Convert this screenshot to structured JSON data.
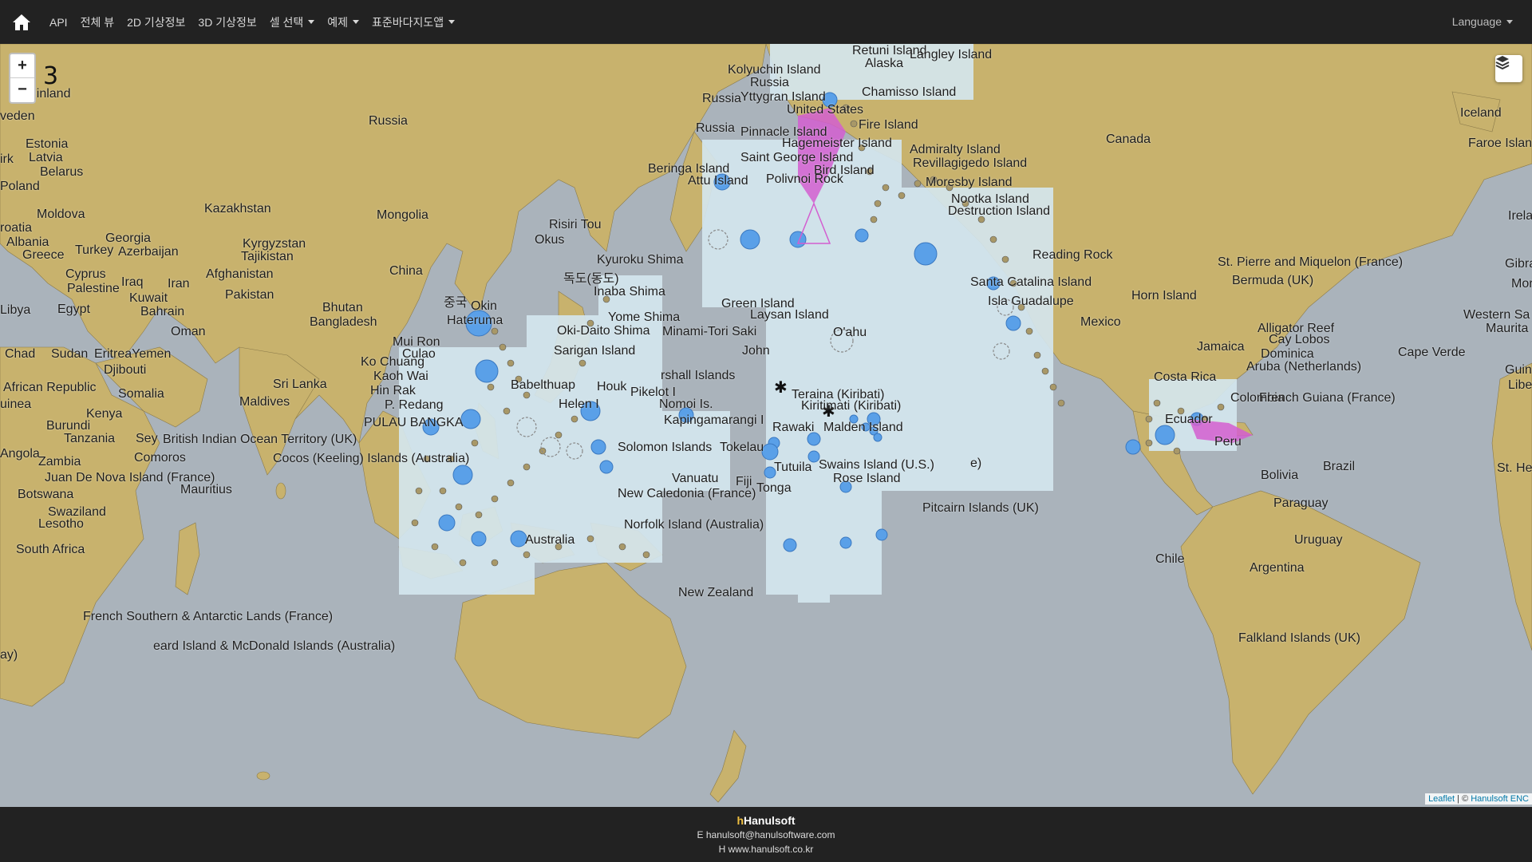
{
  "nav": {
    "items": [
      "API",
      "전체 뷰",
      "2D 기상정보",
      "3D 기상정보"
    ],
    "dropdowns": [
      "셀 선택",
      "예제",
      "표준바다지도앱"
    ],
    "language": "Language"
  },
  "map": {
    "zoom_in": "+",
    "zoom_out": "−",
    "zoom_level": "3",
    "attribution_leaflet": "Leaflet",
    "attribution_sep": " | © ",
    "attribution_owner": "Hanulsoft ENC",
    "labels": {
      "finland": "Finland",
      "sweden": "veden",
      "estonia": "Estonia",
      "latvia": "Latvia",
      "belarus": "Belarus",
      "poland": "Poland",
      "moldova": "Moldova",
      "croatia": "roatia",
      "albania": "Albania",
      "greece": "Greece",
      "turkey": "Turkey",
      "georgia": "Georgia",
      "azerbaijan": "Azerbaijan",
      "cyprus": "Cyprus",
      "palestine": "Palestine",
      "libya": "Libya",
      "egypt": "Egypt",
      "iraq": "Iraq",
      "kuwait": "Kuwait",
      "iran": "Iran",
      "bahrain": "Bahrain",
      "oman": "Oman",
      "chad": "Chad",
      "sudan": "Sudan",
      "eritrea_yemen": "EritreaYemen",
      "djibouti": "Djibouti",
      "car": "African Republic",
      "somalia": "Somalia",
      "kenya": "Kenya",
      "burundi": "Burundi",
      "tanzania": "Tanzania",
      "uinea": "uinea",
      "angola": "Angola",
      "zambia": "Zambia",
      "comoros": "Comoros",
      "sey": "Sey",
      "juan": "Juan De Nova Island (France)",
      "mauritius": "Mauritius",
      "botswana": "Botswana",
      "swaziland": "Swaziland",
      "lesotho": "Lesotho",
      "south_africa": "South Africa",
      "russia1": "Russia",
      "kazakhstan": "Kazakhstan",
      "mongolia": "Mongolia",
      "kyrgyzstan": "Kyrgyzstan",
      "tajikistan": "Tajikistan",
      "afghanistan": "Afghanistan",
      "pakistan": "Pakistan",
      "china": "China",
      "bhutan": "Bhutan",
      "bangladesh": "Bangladesh",
      "sri_lanka": "Sri Lanka",
      "maldives": "Maldives",
      "biot": "British Indian Ocean Territory (UK)",
      "cocos": "Cocos (Keeling) Islands (Australia)",
      "ko_chuang": "Ko Chuang",
      "kaoh_wai": "Kaoh Wai",
      "hin_rak": "Hin Rak",
      "p_redang": "P. Redang",
      "pulau_bangka": "PULAU BANGKA",
      "mui_ron": "Mui Ron",
      "culaoc": "Culao",
      "china_kr": "중국",
      "okinawa": "Okin",
      "hateruma": "Hateruma",
      "kyuroku": "Kyuroku Shima",
      "dokdo": "독도(동도)",
      "inaba": "Inaba Shima",
      "yome": "Yome Shima",
      "okidaito": "Oki-Daito Shima",
      "minamitori": "Minami-Tori Saki",
      "sarigan": "Sarigan Island",
      "babelthuap": "Babelthuap",
      "helen": "Helen I",
      "nomoi": "Nomoi Is.",
      "pikelot": "Pikelot I",
      "houk": "Houk",
      "kapinga": "Kapingamarangi I",
      "marshall": "rshall Islands",
      "solomon": "Solomon Islands",
      "tokelau": "Tokelau",
      "vanuatu": "Vanuatu",
      "fiji": "Fiji",
      "tonga": "Tonga",
      "new_caledonia": "New Caledonia (France)",
      "norfolk": "Norfolk Island (Australia)",
      "australia": "Australia",
      "new_zealand": "New Zealand",
      "fsat": "French Southern & Antarctic Lands (France)",
      "heard": "eard Island & McDonald Islands (Australia)",
      "ay": "ay)",
      "risiri": "Risiri Tou",
      "okus": "Okus",
      "kolyuchin": "Kolyuchin Island",
      "russia2": "Russia",
      "russia3": "Russia",
      "russia4": "Russia",
      "yttygran": "Yttygran Island",
      "pinnacle": "Pinnacle Island",
      "united_states": "United States",
      "alaska": "Alaska",
      "chamisso": "Chamisso Island",
      "fire": "Fire Island",
      "hagemeister": "Hagemeister Island",
      "saint_george": "Saint George Island",
      "bird": "Bird Island",
      "beringa": "Beringa Island",
      "attu": "Attu Island",
      "polivnoi": "Polivnoi Rock",
      "admiralty": "Admiralty Island",
      "revillagigedo": "Revillagigedo Island",
      "moresby": "Moresby Island",
      "nootka": "Nootka Island",
      "destruction": "Destruction Island",
      "reading": "Reading Rock",
      "santa_catalina": "Santa Catalina Island",
      "isla_guadalupe": "Isla Guadalupe",
      "green": "Green Island",
      "laysan": "Laysan Island",
      "oahu": "O'ahu",
      "johnston": "John",
      "teraina": "Teraina (Kiribati)",
      "kiritimati": "Kiritimati (Kiribati)",
      "rawaki": "Rawaki",
      "malden": "Malden Island",
      "tutuila": "Tutuila",
      "swains": "Swains Island (U.S.)",
      "rose": "Rose Island",
      "e": "e)",
      "pitcairn": "Pitcairn Islands (UK)",
      "canada": "Canada",
      "iceland": "Iceland",
      "faroe": "Faroe Island",
      "irela": "Irela",
      "st_pierre": "St. Pierre and Miquelon (France)",
      "bermuda": "Bermuda (UK)",
      "horn": "Horn Island",
      "mexico": "Mexico",
      "jamaica": "Jamaica",
      "alligator": "Alligator Reef",
      "cay_lobos": "Cay Lobos",
      "dominica": "Dominica",
      "aruba": "Aruba (Netherlands)",
      "costa_rica": "Costa Rica",
      "colombia": "Colombia",
      "french_guiana": "French Guiana (France)",
      "ecuador": "Ecuador",
      "peru": "Peru",
      "brazil": "Brazil",
      "bolivia": "Bolivia",
      "paraguay": "Paraguay",
      "uruguay": "Uruguay",
      "chile": "Chile",
      "argentina": "Argentina",
      "falkland": "Falkland Islands (UK)",
      "cape_verde": "Cape Verde",
      "western_sahara": "Western Sa",
      "mauritania": "Maurita",
      "gibra": "Gibra",
      "moro": "Mor",
      "guinea_r": "Guine",
      "liberia": "Libe",
      "st_he": "St. He",
      "irk": "irk",
      "langley": "Langley Island",
      "retuni": "Retuni Island"
    }
  },
  "footer": {
    "brand": "Hanulsoft",
    "email_prefix": "E",
    "email": "hanulsoft@hanulsoftware.com",
    "home_prefix": "H",
    "website": "www.hanulsoft.co.kr"
  },
  "colors": {
    "land": "#c8b26d",
    "sea": "#aab3bb",
    "chart_cover": "#d4e6ee",
    "chart_blue": "#5aa0e8",
    "magenta": "#d35ed0",
    "navbar": "#222222"
  }
}
